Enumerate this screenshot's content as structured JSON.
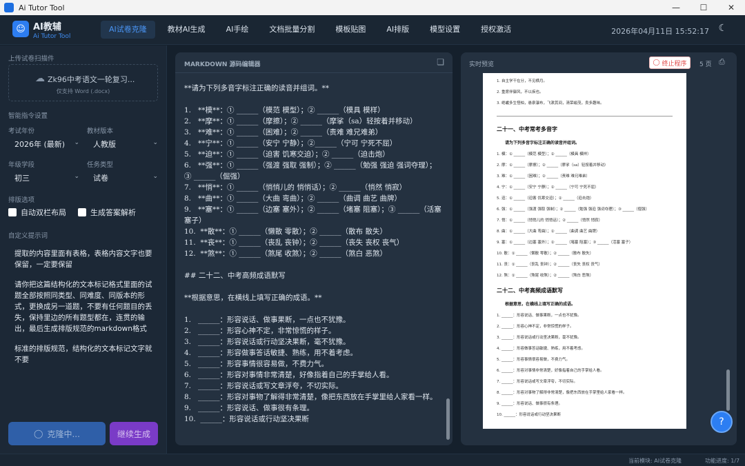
{
  "window": {
    "title": "Ai Tutor Tool"
  },
  "brand": {
    "name": "AI教辅",
    "sub": "Ai Tutor Tool"
  },
  "nav": {
    "items": [
      "AI试卷克隆",
      "教材AI生成",
      "AI手绘",
      "文档批量分割",
      "模板贴图",
      "AI排版",
      "模型设置",
      "授权激活"
    ],
    "active": 0
  },
  "clock": "2026年04月11日 15:52:17",
  "sidebar": {
    "upload_label": "上传试卷扫描件",
    "upload_file": "Zk96中考语文一轮复习...",
    "upload_hint": "仅支持 Word (.docx)",
    "smart_label": "智能指令设置",
    "year_label": "考试年份",
    "year_value": "2026年 (最新)",
    "edition_label": "教材版本",
    "edition_value": "人教版",
    "grade_label": "年级学段",
    "grade_value": "初三",
    "task_label": "任务类型",
    "task_value": "试卷",
    "layout_label": "排版选项",
    "opt_two_col": "自动双栏布局",
    "opt_answer": "生成答案解析",
    "custom_label": "自定义提示词",
    "prompt_p1": "提取的内容里面有表格，表格内容文字也要保留，一定要保留",
    "prompt_p2": "请你把这篇结构化的文本标记格式里面的试题全部按照同类型、同难度、同版本的形式，更换成另一道题，不要有任何题目的丢失，保持里边的所有题型都在，连贯的输出，最后生成排版规范的markdown格式",
    "prompt_p3": "标准的排版规范，结构化的文本标记文字就不要",
    "btn_clone": "克隆中...",
    "btn_continue": "继续生成"
  },
  "editor": {
    "title": "MARKDOWN 源码编辑器",
    "lines": [
      "**请为下列多音字标注正确的读音并组词。**",
      "",
      "1.   **模**：① ______（模范 模型）；② ______（模具 模样）",
      "2.   **摩**：① ______（摩擦）；② ______（摩挲（sa）轻按着并移动）",
      "3.   **难**：① ______（困难）；② ______（责难 难兄难弟）",
      "4.   **宁**：① ______（安宁 宁静）；②______（宁可 宁死不屈）",
      "5.   **迫**：① ______（迫害 饥寒交迫）；② ______（迫击炮）",
      "6.   **强**：① ______（强渡 强取 强制）；② ______（勉强 强迫 强词夺理）；③ ______（倔强）",
      "7.   **悄**：① ______（悄悄儿的 悄悄话）；② ______（悄然 悄寂）",
      "8.   **曲**：① ______（大曲 弯曲）；② ______（曲调 曲艺 曲牌）",
      "9.   **塞**：① ______（边塞 塞外）；② ______（堵塞 阻塞）；③ ______（活塞 塞子）",
      "10.  **散**：① ______（懒散 零散）；② ______（散布 散失）",
      "11.  **丧**：① ______（丧乱 丧钟）；② ______（丧失 丧权 丧气）",
      "12.  **煞**：① ______（煞尾 收煞）；② ______（煞白 恶煞）",
      "",
      "## 二十二、中考高频成语默写",
      "",
      "**根据意思，在横线上填写正确的成语。**",
      "",
      "1.   ______：形容说话、做事果断，一点也不犹豫。",
      "2.   ______：形容心神不定，非常惊慌的样子。",
      "3.   ______：形容说话或行动坚决果断，毫不犹豫。",
      "4.   ______：形容做事答话敏捷、熟练，用不着考虑。",
      "5.   ______：形容事情很容易做，不费力气。",
      "6.   ______：形容对事情非常清楚，好像指着自己的手掌给人看。",
      "7.   ______：形容说话或写文章浮夸，不切实际。",
      "8.   ______：形容对事物了解得非常清楚，像把东西放在手掌里给人家看一样。",
      "9.   ______：形容说话、做事很有条理。",
      "10.  ______：形容说话或行动坚决果断"
    ]
  },
  "preview": {
    "title": "实时预览",
    "stop_label": "终止程序",
    "pages": "5 页",
    "page_lines": [
      {
        "t": "1.  自主学干在分，不见横月。",
        "k": "n"
      },
      {
        "t": "2.  重席伴御风，不以疾也。",
        "k": "n"
      },
      {
        "t": "3.  绝巘多生怪柏，悬泉瀑布，飞漱其间，清荣峻茂，良多趣味。",
        "k": "n"
      },
      {
        "t": "",
        "k": "rule"
      },
      {
        "t": "二十一、中考常考多音字",
        "k": "h"
      },
      {
        "t": "请为下列多音字标注正确的读音并组词。",
        "k": "b"
      },
      {
        "t": "1.  模：① ______（模范 模型）；② ______（模具 模样）",
        "k": "n"
      },
      {
        "t": "2.  摩：① ______（摩擦）；② ______（摩挲（sa）轻按着并移动）",
        "k": "n"
      },
      {
        "t": "3.  难：① ______（困难）；② ______（责难 难兄难弟）",
        "k": "n"
      },
      {
        "t": "4.  宁：① ______（安宁 宁静）；② ______（宁可 宁死不屈）",
        "k": "n"
      },
      {
        "t": "5.  迫：① ______（迫害 饥寒交迫）；② ______（迫击炮）",
        "k": "n"
      },
      {
        "t": "6.  强：① ______（强渡 强取 强制）；② ______（勉强 强迫 强词夺理）；③ ______（倔强）",
        "k": "n"
      },
      {
        "t": "7.  悄：① ______（悄悄儿的 悄悄话）；② ______（悄然 悄寂）",
        "k": "n"
      },
      {
        "t": "8.  曲：① ______（大曲 弯曲）；② ______（曲调 曲艺 曲牌）",
        "k": "n"
      },
      {
        "t": "9.  塞：① ______（边塞 塞外）；② ______（堵塞 阻塞）；③ ______（活塞 塞子）",
        "k": "n"
      },
      {
        "t": "10. 散：① ______（懒散 零散）；② ______（散布 散失）",
        "k": "n"
      },
      {
        "t": "11. 丧：① ______（丧乱 丧钟）；② ______（丧失 丧权 丧气）",
        "k": "n"
      },
      {
        "t": "12. 煞：① ______（煞尾 收煞）；② ______（煞白 恶煞）",
        "k": "n"
      },
      {
        "t": "二十二、中考高频成语默写",
        "k": "h"
      },
      {
        "t": "根据意思，在横线上填写正确的成语。",
        "k": "b"
      },
      {
        "t": "1.  ______：形容说话、做事果断，一点也不犹豫。",
        "k": "n"
      },
      {
        "t": "2.  ______：形容心神不定，非常惊慌的样子。",
        "k": "n"
      },
      {
        "t": "3.  ______：形容说话或行动坚决果断，毫不犹豫。",
        "k": "n"
      },
      {
        "t": "4.  ______：形容做事答话敏捷、熟练，用不着考虑。",
        "k": "n"
      },
      {
        "t": "5.  ______：形容事情很容易做，不费力气。",
        "k": "n"
      },
      {
        "t": "6.  ______：形容对事情非常清楚，好像指着自己的手掌给人看。",
        "k": "n"
      },
      {
        "t": "7.  ______：形容说话或写文章浮夸，不切实际。",
        "k": "n"
      },
      {
        "t": "8.  ______：形容对事物了解得非常清楚，像把东西放在手掌里给人家看一样。",
        "k": "n"
      },
      {
        "t": "9.  ______：形容说话、做事很有条理。",
        "k": "n"
      },
      {
        "t": "10. ______：形容说话或行动坚决果断",
        "k": "n"
      }
    ]
  },
  "status": {
    "module": "当前模块: AI试卷克隆",
    "progress": "功能进度: 1/7"
  }
}
